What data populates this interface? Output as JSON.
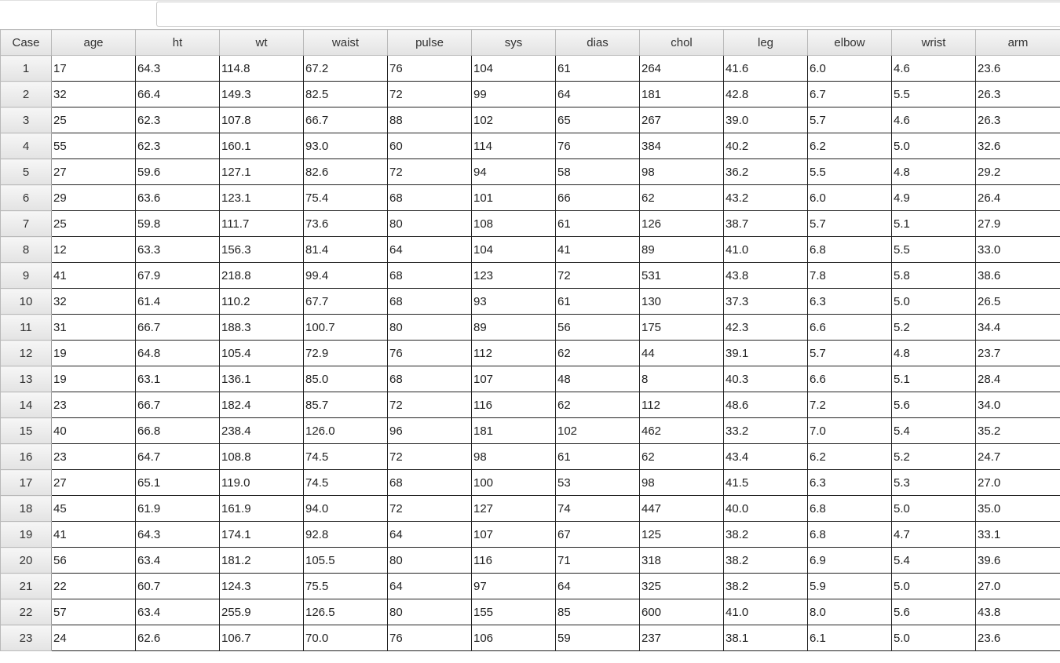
{
  "formula_bar": {
    "value": ""
  },
  "table": {
    "columns": [
      "Case",
      "age",
      "ht",
      "wt",
      "waist",
      "pulse",
      "sys",
      "dias",
      "chol",
      "leg",
      "elbow",
      "wrist",
      "arm"
    ],
    "rows": [
      [
        "1",
        "17",
        "64.3",
        "114.8",
        "67.2",
        "76",
        "104",
        "61",
        "264",
        "41.6",
        "6.0",
        "4.6",
        "23.6"
      ],
      [
        "2",
        "32",
        "66.4",
        "149.3",
        "82.5",
        "72",
        "99",
        "64",
        "181",
        "42.8",
        "6.7",
        "5.5",
        "26.3"
      ],
      [
        "3",
        "25",
        "62.3",
        "107.8",
        "66.7",
        "88",
        "102",
        "65",
        "267",
        "39.0",
        "5.7",
        "4.6",
        "26.3"
      ],
      [
        "4",
        "55",
        "62.3",
        "160.1",
        "93.0",
        "60",
        "114",
        "76",
        "384",
        "40.2",
        "6.2",
        "5.0",
        "32.6"
      ],
      [
        "5",
        "27",
        "59.6",
        "127.1",
        "82.6",
        "72",
        "94",
        "58",
        "98",
        "36.2",
        "5.5",
        "4.8",
        "29.2"
      ],
      [
        "6",
        "29",
        "63.6",
        "123.1",
        "75.4",
        "68",
        "101",
        "66",
        "62",
        "43.2",
        "6.0",
        "4.9",
        "26.4"
      ],
      [
        "7",
        "25",
        "59.8",
        "111.7",
        "73.6",
        "80",
        "108",
        "61",
        "126",
        "38.7",
        "5.7",
        "5.1",
        "27.9"
      ],
      [
        "8",
        "12",
        "63.3",
        "156.3",
        "81.4",
        "64",
        "104",
        "41",
        "89",
        "41.0",
        "6.8",
        "5.5",
        "33.0"
      ],
      [
        "9",
        "41",
        "67.9",
        "218.8",
        "99.4",
        "68",
        "123",
        "72",
        "531",
        "43.8",
        "7.8",
        "5.8",
        "38.6"
      ],
      [
        "10",
        "32",
        "61.4",
        "110.2",
        "67.7",
        "68",
        "93",
        "61",
        "130",
        "37.3",
        "6.3",
        "5.0",
        "26.5"
      ],
      [
        "11",
        "31",
        "66.7",
        "188.3",
        "100.7",
        "80",
        "89",
        "56",
        "175",
        "42.3",
        "6.6",
        "5.2",
        "34.4"
      ],
      [
        "12",
        "19",
        "64.8",
        "105.4",
        "72.9",
        "76",
        "112",
        "62",
        "44",
        "39.1",
        "5.7",
        "4.8",
        "23.7"
      ],
      [
        "13",
        "19",
        "63.1",
        "136.1",
        "85.0",
        "68",
        "107",
        "48",
        "8",
        "40.3",
        "6.6",
        "5.1",
        "28.4"
      ],
      [
        "14",
        "23",
        "66.7",
        "182.4",
        "85.7",
        "72",
        "116",
        "62",
        "112",
        "48.6",
        "7.2",
        "5.6",
        "34.0"
      ],
      [
        "15",
        "40",
        "66.8",
        "238.4",
        "126.0",
        "96",
        "181",
        "102",
        "462",
        "33.2",
        "7.0",
        "5.4",
        "35.2"
      ],
      [
        "16",
        "23",
        "64.7",
        "108.8",
        "74.5",
        "72",
        "98",
        "61",
        "62",
        "43.4",
        "6.2",
        "5.2",
        "24.7"
      ],
      [
        "17",
        "27",
        "65.1",
        "119.0",
        "74.5",
        "68",
        "100",
        "53",
        "98",
        "41.5",
        "6.3",
        "5.3",
        "27.0"
      ],
      [
        "18",
        "45",
        "61.9",
        "161.9",
        "94.0",
        "72",
        "127",
        "74",
        "447",
        "40.0",
        "6.8",
        "5.0",
        "35.0"
      ],
      [
        "19",
        "41",
        "64.3",
        "174.1",
        "92.8",
        "64",
        "107",
        "67",
        "125",
        "38.2",
        "6.8",
        "4.7",
        "33.1"
      ],
      [
        "20",
        "56",
        "63.4",
        "181.2",
        "105.5",
        "80",
        "116",
        "71",
        "318",
        "38.2",
        "6.9",
        "5.4",
        "39.6"
      ],
      [
        "21",
        "22",
        "60.7",
        "124.3",
        "75.5",
        "64",
        "97",
        "64",
        "325",
        "38.2",
        "5.9",
        "5.0",
        "27.0"
      ],
      [
        "22",
        "57",
        "63.4",
        "255.9",
        "126.5",
        "80",
        "155",
        "85",
        "600",
        "41.0",
        "8.0",
        "5.6",
        "43.8"
      ],
      [
        "23",
        "24",
        "62.6",
        "106.7",
        "70.0",
        "76",
        "106",
        "59",
        "237",
        "38.1",
        "6.1",
        "5.0",
        "23.6"
      ]
    ]
  }
}
